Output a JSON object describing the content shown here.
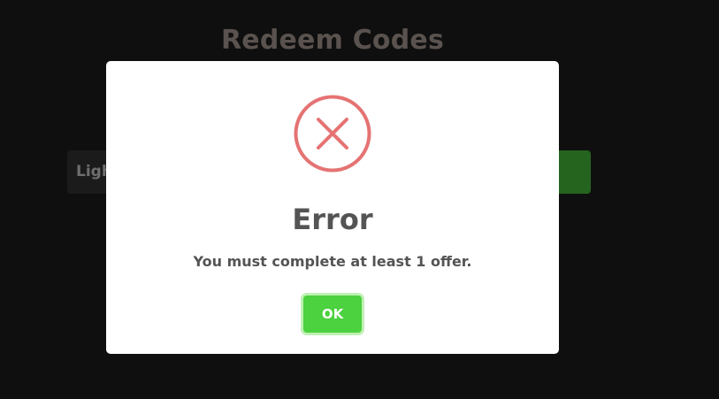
{
  "page": {
    "title": "Redeem Codes"
  },
  "form": {
    "code_input_value": "Lightbulb"
  },
  "dialog": {
    "icon": "x-circle-icon",
    "title": "Error",
    "message": "You must complete at least 1 offer.",
    "ok_label": "OK"
  },
  "colors": {
    "background": "#171717",
    "page_title": "#8a7f78",
    "input_bg": "#2a2a2a",
    "redeem_button": "#3a9a31",
    "error_icon": "#e57373",
    "dialog_text": "#545454",
    "ok_button": "#4cd13f"
  }
}
